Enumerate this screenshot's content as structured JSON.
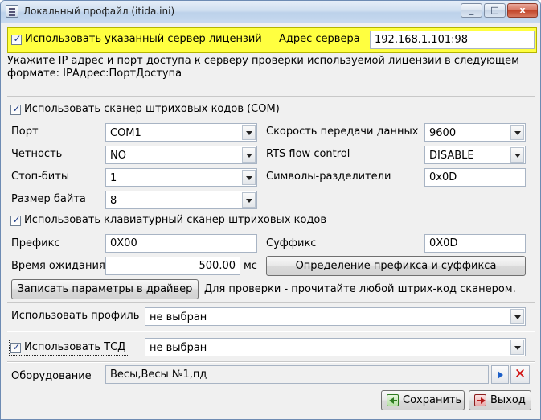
{
  "window": {
    "title": "Локальный профайл (itida.ini)",
    "controls": {
      "minimize": "_",
      "maximize": "□",
      "close": "x"
    }
  },
  "license": {
    "use_server_label": "Использовать указанный сервер лицензий",
    "use_server_checked": true,
    "server_address_label": "Адрес сервера",
    "server_address_value": "192.168.1.101:98",
    "hint_line1": "Укажите IP адрес и порт доступа к серверу проверки используемой лицензии в следующем",
    "hint_line2": "формате: IPАдрес:ПортДоступа",
    "panel_color": "#ffff40"
  },
  "scanner": {
    "use_com_label": "Использовать сканер штриховых кодов (COM)",
    "use_com_checked": true,
    "port_label": "Порт",
    "port_value": "COM1",
    "parity_label": "Четность",
    "parity_value": "NO",
    "stop_bits_label": "Стоп-биты",
    "stop_bits_value": "1",
    "byte_size_label": "Размер байта",
    "byte_size_value": "8",
    "baud_label": "Скорость передачи данных",
    "baud_value": "9600",
    "rts_label": "RTS flow control",
    "rts_value": "DISABLE",
    "delimiters_label": "Символы-разделители",
    "delimiters_value": "0x0D"
  },
  "keyboard_scanner": {
    "use_label": "Использовать клавиатурный сканер штриховых кодов",
    "use_checked": true,
    "prefix_label": "Префикс",
    "prefix_value": "0X00",
    "suffix_label": "Суффикс",
    "suffix_value": "0X0D",
    "timeout_label": "Время ожидания",
    "timeout_value": "500.00",
    "timeout_unit": "мс",
    "detect_button": "Определение префикса и суффикса"
  },
  "driver": {
    "write_button": "Записать параметры в драйвер",
    "hint": "Для проверки - прочитайте любой штрих-код сканером."
  },
  "profile": {
    "label": "Использовать профиль",
    "value": "не выбран"
  },
  "tsd": {
    "label": "Использовать ТСД",
    "checked": true,
    "value": "не выбран"
  },
  "equipment": {
    "label": "Оборудование",
    "value": "Весы,Весы №1,пд",
    "open_icon": "play-arrow-icon",
    "delete_icon": "red-x-icon"
  },
  "footer": {
    "save_button": "Сохранить",
    "exit_button": "Выход",
    "save_icon": "save-icon",
    "exit_icon": "exit-icon"
  }
}
